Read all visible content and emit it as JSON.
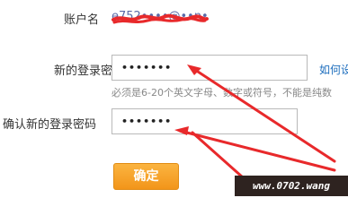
{
  "account": {
    "label": "账户名",
    "value": "e752••••@••n•••"
  },
  "new_password": {
    "label": "新的登录密码",
    "value": "•••••••",
    "help_link": "如何设",
    "hint": "必须是6-20个英文字母、数字或符号，不能是纯数"
  },
  "confirm_password": {
    "label": "确认新的登录密码",
    "value": "•••••••"
  },
  "confirm_button": {
    "label": "确定"
  },
  "watermark": {
    "text": "www.0702.wang"
  },
  "colors": {
    "arrow": "#e8292b",
    "button": "#f5a12a",
    "link": "#1c6dbd"
  }
}
